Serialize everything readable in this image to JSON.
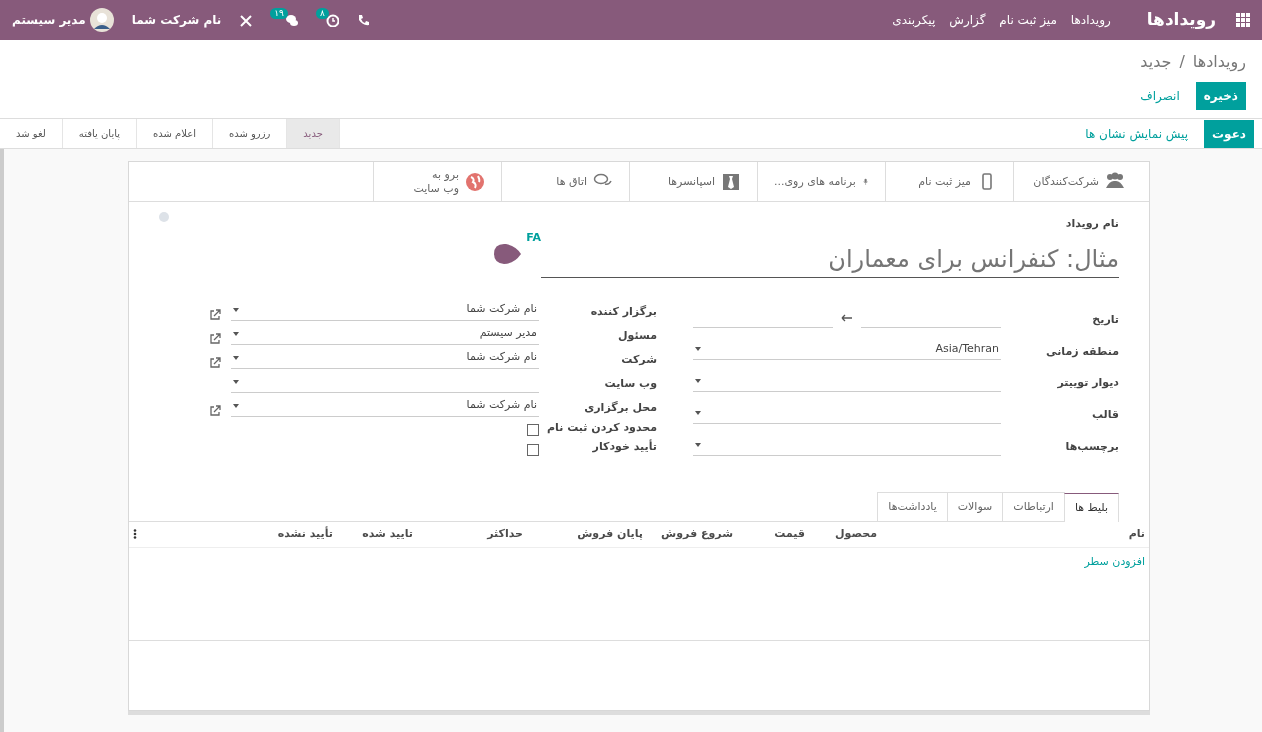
{
  "navbar": {
    "app_title": "رویدادها",
    "menu": [
      "رویدادها",
      "میز ثبت نام",
      "گزارش",
      "پیکربندی"
    ],
    "systray": [
      {
        "kind": "phone"
      },
      {
        "kind": "activity",
        "count": "۸"
      },
      {
        "kind": "messages",
        "count": "۱۹"
      },
      {
        "kind": "debug"
      }
    ],
    "company": "نام شرکت شما",
    "user": "مدیر سیستم"
  },
  "breadcrumb": {
    "parent": "رویدادها",
    "separator": "/",
    "current": "جدید"
  },
  "actions": [
    {
      "label": "ذخیره",
      "kind": "primary"
    },
    {
      "label": "انصراف",
      "kind": "link"
    }
  ],
  "header_buttons": [
    {
      "label": "دعوت",
      "kind": "primary"
    },
    {
      "label": "پیش نمایش نشان ها",
      "kind": "link"
    }
  ],
  "stages": [
    {
      "label": "جدید",
      "selected": true
    },
    {
      "label": "رزرو شده",
      "selected": false
    },
    {
      "label": "اعلام شده",
      "selected": false
    },
    {
      "label": "پایان یافته",
      "selected": false
    },
    {
      "label": "لغو شد",
      "selected": false
    }
  ],
  "smart_buttons": [
    {
      "kind": "attendees",
      "lines": [
        "شرکت‌کنندگان"
      ]
    },
    {
      "kind": "desk",
      "lines": [
        "میز ثبت نام"
      ]
    },
    {
      "kind": "tracks",
      "lines": [
        "برنامه های روی..."
      ]
    },
    {
      "kind": "sponsors",
      "lines": [
        "اسپانسرها"
      ]
    },
    {
      "kind": "rooms",
      "lines": [
        "اتاق ها"
      ]
    },
    {
      "kind": "website",
      "lines": [
        "برو به",
        "وب سایت"
      ]
    }
  ],
  "form": {
    "title_label": "نام رویداد",
    "title_placeholder": "مثال: کنفرانس برای معماران",
    "language": "FA",
    "fields_right": [
      {
        "label": "تاریخ",
        "kind": "daterange"
      },
      {
        "label": "منطقه زمانی",
        "kind": "select",
        "value": "Asia/Tehran"
      },
      {
        "label": "دیوار توییتر",
        "kind": "select"
      },
      {
        "label": "قالب",
        "kind": "select"
      },
      {
        "label": "برچسب‌ها",
        "kind": "select"
      }
    ],
    "fields_left": [
      {
        "label": "برگزار کننده",
        "kind": "many2one",
        "value": "نام شرکت شما"
      },
      {
        "label": "مسئول",
        "kind": "many2one",
        "value": "مدیر سیستم"
      },
      {
        "label": "شرکت",
        "kind": "many2one",
        "value": "نام شرکت شما"
      },
      {
        "label": "وب سایت",
        "kind": "select"
      },
      {
        "label": "محل برگزاری",
        "kind": "many2one",
        "value": "نام شرکت شما"
      },
      {
        "label": "محدود کردن ثبت نام",
        "kind": "checkbox",
        "checked": false
      },
      {
        "label": "تأیید خودکار",
        "kind": "checkbox",
        "checked": false
      }
    ]
  },
  "notebook": {
    "tabs": [
      {
        "label": "بلیط ها",
        "selected": true
      },
      {
        "label": "ارتباطات",
        "selected": false
      },
      {
        "label": "سوالات",
        "selected": false
      },
      {
        "label": "یادداشت‌ها",
        "selected": false
      }
    ],
    "columns": [
      "نام",
      "محصول",
      "قیمت",
      "شروع فروش",
      "پایان فروش",
      "حداکثر",
      "تایید شده",
      "تأیید نشده"
    ],
    "add_line": "افزودن سطر"
  }
}
